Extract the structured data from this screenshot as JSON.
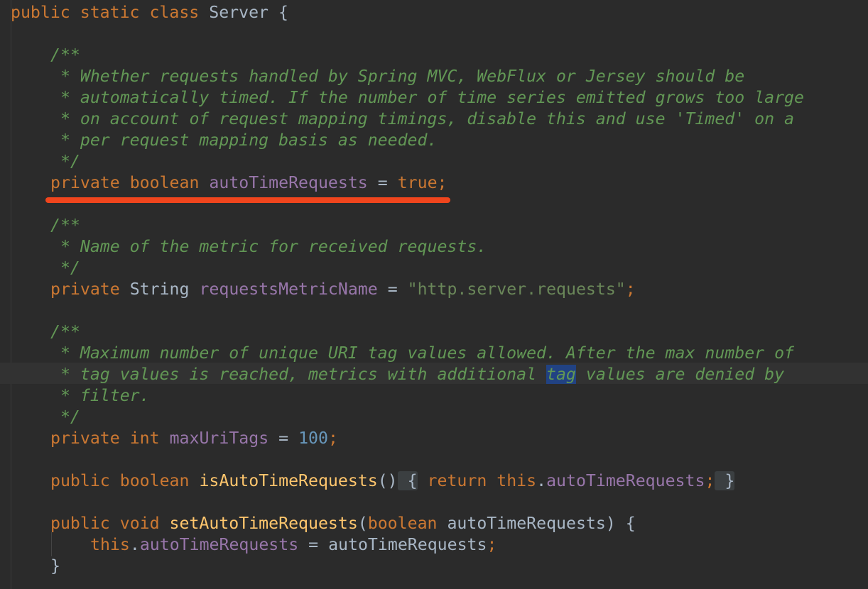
{
  "code": {
    "class_decl": {
      "kw_public": "public",
      "kw_static": "static",
      "kw_class": "class",
      "name": "Server",
      "brace": "{"
    },
    "doc1": {
      "open": "/**",
      "line1": " * Whether requests handled by Spring MVC, WebFlux or Jersey should be",
      "line2": " * automatically timed. If the number of time series emitted grows too large",
      "line3": " * on account of request mapping timings, disable this and use 'Timed' on a",
      "line4": " * per request mapping basis as needed.",
      "close": " */"
    },
    "field1": {
      "kw_private": "private",
      "type": "boolean",
      "name": "autoTimeRequests",
      "eq": "=",
      "value": "true",
      "semi": ";"
    },
    "doc2": {
      "open": "/**",
      "line1": " * Name of the metric for received requests.",
      "close": " */"
    },
    "field2": {
      "kw_private": "private",
      "type": "String",
      "name": "requestsMetricName",
      "eq": "=",
      "value": "\"http.server.requests\"",
      "semi": ";"
    },
    "doc3": {
      "open": "/**",
      "line1": " * Maximum number of unique URI tag values allowed. After the max number of",
      "line2_before": " * tag values is reached, metrics with additional ",
      "line2_selected": "tag",
      "line2_after": " values are denied by",
      "line3": " * filter.",
      "close": " */"
    },
    "field3": {
      "kw_private": "private",
      "type": "int",
      "name": "maxUriTags",
      "eq": "=",
      "value": "100",
      "semi": ";"
    },
    "getter": {
      "kw_public": "public",
      "type": "boolean",
      "name": "isAutoTimeRequests",
      "parens": "()",
      "open_brace": " {",
      "kw_return": "return",
      "kw_this": "this",
      "dot": ".",
      "field": "autoTimeRequests",
      "semi": ";",
      "close_brace": " }"
    },
    "setter": {
      "kw_public": "public",
      "kw_void": "void",
      "name": "setAutoTimeRequests",
      "paren_open": "(",
      "param_type": "boolean",
      "param_name": "autoTimeRequests",
      "paren_close": ")",
      "brace_open": "{",
      "body_this": "this",
      "body_dot": ".",
      "body_field": "autoTimeRequests",
      "body_eq": "=",
      "body_value": "autoTimeRequests",
      "body_semi": ";",
      "brace_close": "}"
    }
  },
  "colors": {
    "background": "#2b2b2b",
    "keyword": "#cc7832",
    "field": "#9876aa",
    "string": "#6a8759",
    "number": "#6897bb",
    "doc_comment": "#629755",
    "method": "#ffc66d",
    "plain": "#a9b7c6",
    "selection": "#214283",
    "annotation_underline": "#f0451d"
  }
}
